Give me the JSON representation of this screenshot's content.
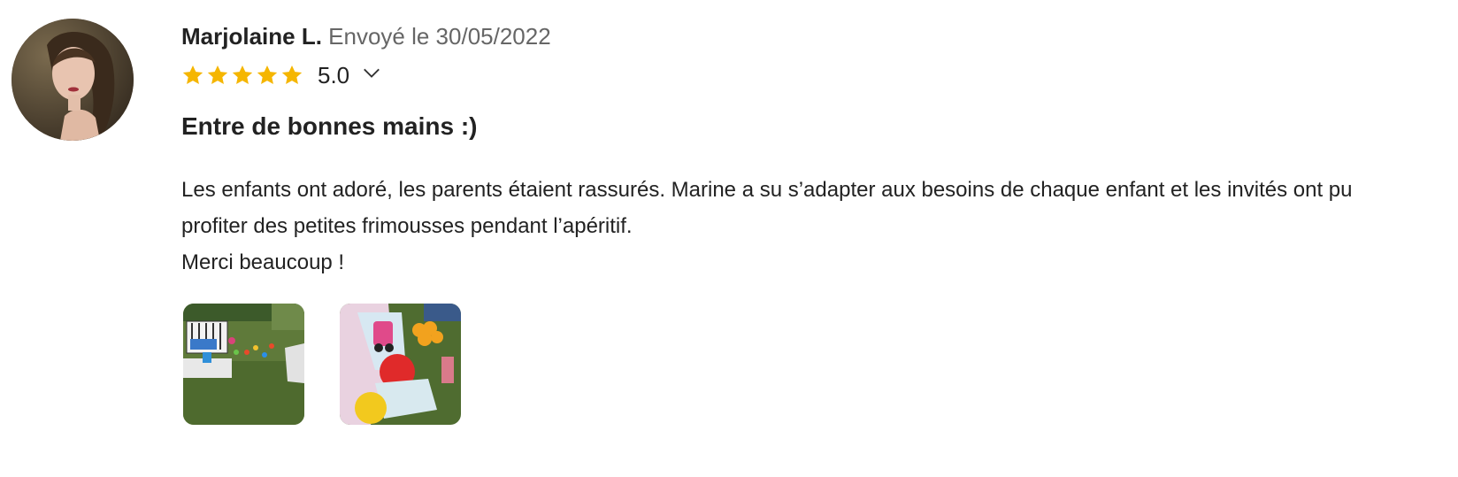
{
  "review": {
    "author": "Marjolaine L.",
    "sent": "Envoyé le 30/05/2022",
    "rating": 5,
    "score": "5.0",
    "title": "Entre de bonnes mains :)",
    "body": "Les enfants ont adoré, les parents étaient rassurés. Marine a su s’adapter aux besoins de chaque enfant et les invités ont pu profiter des petites frimousses pendant l’apéritif.\nMerci beaucoup !",
    "avatar_icon": "avatar-photo",
    "photos": [
      "review-photo-1",
      "review-photo-2"
    ]
  },
  "colors": {
    "star": "#F5B600",
    "text": "#222222",
    "muted": "#666666"
  }
}
